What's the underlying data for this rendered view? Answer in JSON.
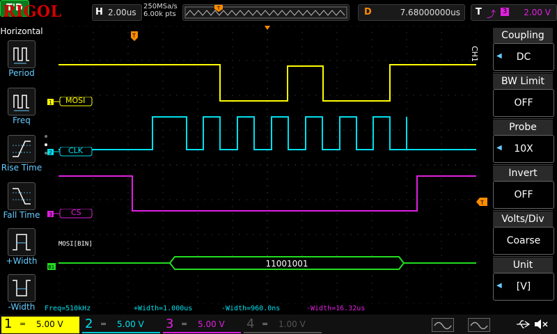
{
  "header": {
    "brand": "RIGOL",
    "trigger_status": "T'D",
    "horizontal_key": "H",
    "timebase": "2.00us",
    "sample_rate": "250MSa/s",
    "memory_depth": "6.00k pts",
    "delay_key": "D",
    "delay_value": "7.68000000us",
    "trigger_key": "T",
    "trigger_source": "3",
    "trigger_level": "2.00 V"
  },
  "left_panel": {
    "title": "Horizontal",
    "buttons": [
      "Period",
      "Freq",
      "Rise Time",
      "Fall Time",
      "+Width",
      "-Width"
    ]
  },
  "channels_on_screen": {
    "ch1_label": "MOSI",
    "ch2_label": "CLK",
    "ch3_label": "CS",
    "decode_title": "MOSI[BIN]",
    "decode_value": "11001001",
    "marker_1": "1",
    "marker_2": "2",
    "marker_3": "3",
    "marker_b1": "B1",
    "trigger_marker": "T"
  },
  "right_menu": {
    "channel_tag": "CH1",
    "items": [
      {
        "label": "Coupling",
        "value": "DC"
      },
      {
        "label": "BW Limit",
        "value": "OFF"
      },
      {
        "label": "Probe",
        "value": "10X"
      },
      {
        "label": "Invert",
        "value": "OFF"
      },
      {
        "label": "Volts/Div",
        "value": "Coarse"
      },
      {
        "label": "Unit",
        "value": "[V]"
      }
    ]
  },
  "measurements": {
    "freq": "Freq=510kHz",
    "pos_width": "+Width=1.000us",
    "neg_width": "-Width=960.0ns",
    "neg_width_ch3": "-Width=16.32us"
  },
  "bottom_bar": {
    "ch1": {
      "num": "1",
      "coupling": "=",
      "scale": "5.00 V"
    },
    "ch2": {
      "num": "2",
      "coupling": "=",
      "scale": "5.00 V"
    },
    "ch3": {
      "num": "3",
      "coupling": "=",
      "scale": "5.00 V"
    },
    "ch4": {
      "num": "4",
      "coupling": "=",
      "scale": "1.00 V"
    }
  },
  "colors": {
    "ch1": "#ffff00",
    "ch2": "#00e0ee",
    "ch3": "#e020e0",
    "decode": "#22dd22",
    "accent": "#ff8c00"
  },
  "icons": [
    "period-icon",
    "freq-icon",
    "rise-time-icon",
    "fall-time-icon",
    "pos-width-icon",
    "neg-width-icon",
    "usb-icon",
    "speaker-muted-icon"
  ]
}
